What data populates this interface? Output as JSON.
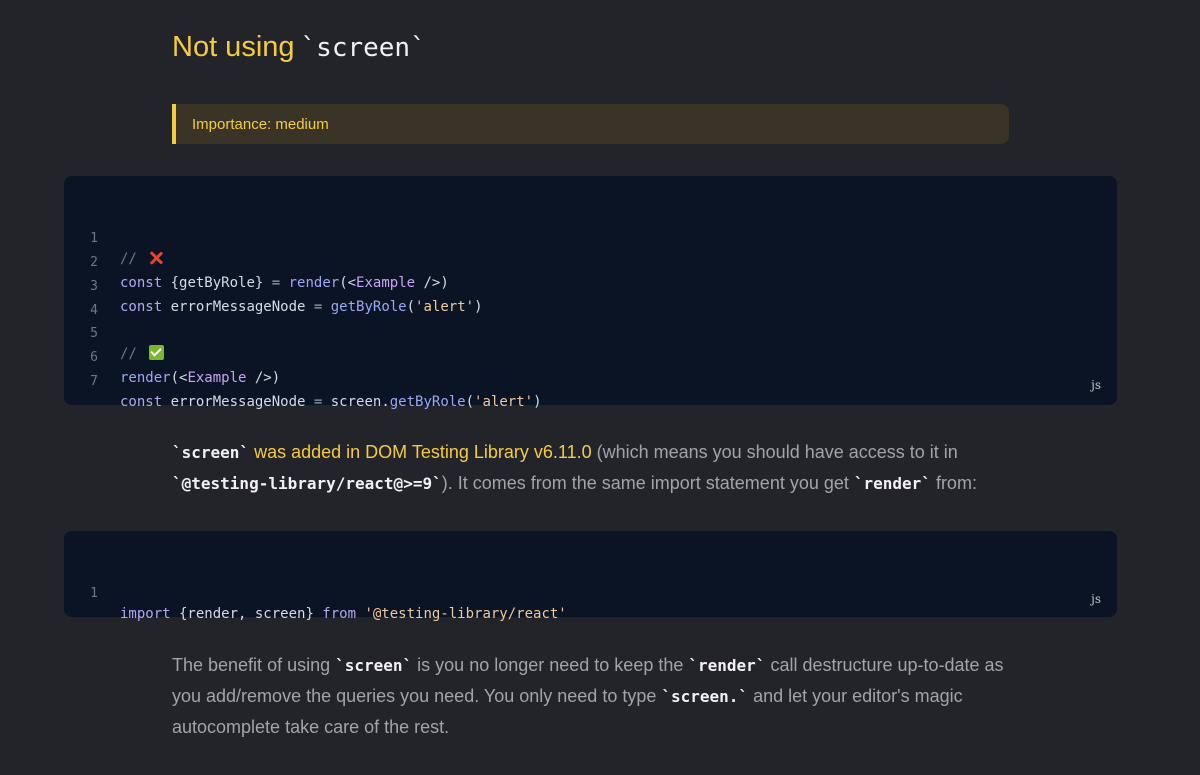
{
  "heading": {
    "text": "Not using",
    "code": "`screen`"
  },
  "callout": {
    "text": "Importance: medium"
  },
  "code_block_1": {
    "language": "js",
    "line_numbers": [
      "1",
      "2",
      "3",
      "4",
      "5",
      "6",
      "7"
    ],
    "lines": {
      "l1_comment": "// ",
      "l2_const": "const",
      "l2_destructure": " {getByRole} ",
      "l2_eq": "=",
      "l2_render": " render",
      "l2_open": "(<",
      "l2_comp": "Example",
      "l2_close": " />)",
      "l3_const": "const",
      "l3_name": " errorMessageNode ",
      "l3_eq": "=",
      "l3_fn": " getByRole",
      "l3_p1": "(",
      "l3_str": "'alert'",
      "l3_p2": ")",
      "l5_comment": "// ",
      "l6_render": "render",
      "l6_open": "(<",
      "l6_comp": "Example",
      "l6_close": " />)",
      "l7_const": "const",
      "l7_name": " errorMessageNode ",
      "l7_eq": "=",
      "l7_obj": " screen.",
      "l7_fn": "getByRole",
      "l7_p1": "(",
      "l7_str": "'alert'",
      "l7_p2": ")"
    },
    "icons": [
      "cross-mark-icon",
      "check-mark-icon"
    ]
  },
  "paragraph_1": {
    "code_screen": "`screen`",
    "highlight": "was added in DOM Testing Library v6.11.0",
    "text_a": " (which means you should have access to it in ",
    "code_pkg": "`@testing-library/react@>=9`",
    "text_b": "). It comes from the same import statement you get ",
    "code_render": "`render`",
    "text_c": " from:"
  },
  "code_block_2": {
    "language": "js",
    "line_numbers": [
      "1"
    ],
    "import_kw": "import",
    "names": " {render, screen} ",
    "from_kw": "from",
    "source": " '@testing-library/react'"
  },
  "paragraph_2": {
    "text_a": "The benefit of using ",
    "code_screen": "`screen`",
    "text_b": " is you no longer need to keep the ",
    "code_render": "`render`",
    "text_c": " call destructure up-to-date as you add/remove the queries you need. You only need to type ",
    "code_screen_dot": "`screen.`",
    "text_d": " and let your editor's magic autocomplete take care of the rest."
  },
  "colors": {
    "background": "#23232a",
    "accent_yellow": "#f5cb42",
    "code_background": "#0b1424",
    "callout_background": "#3a3427"
  }
}
